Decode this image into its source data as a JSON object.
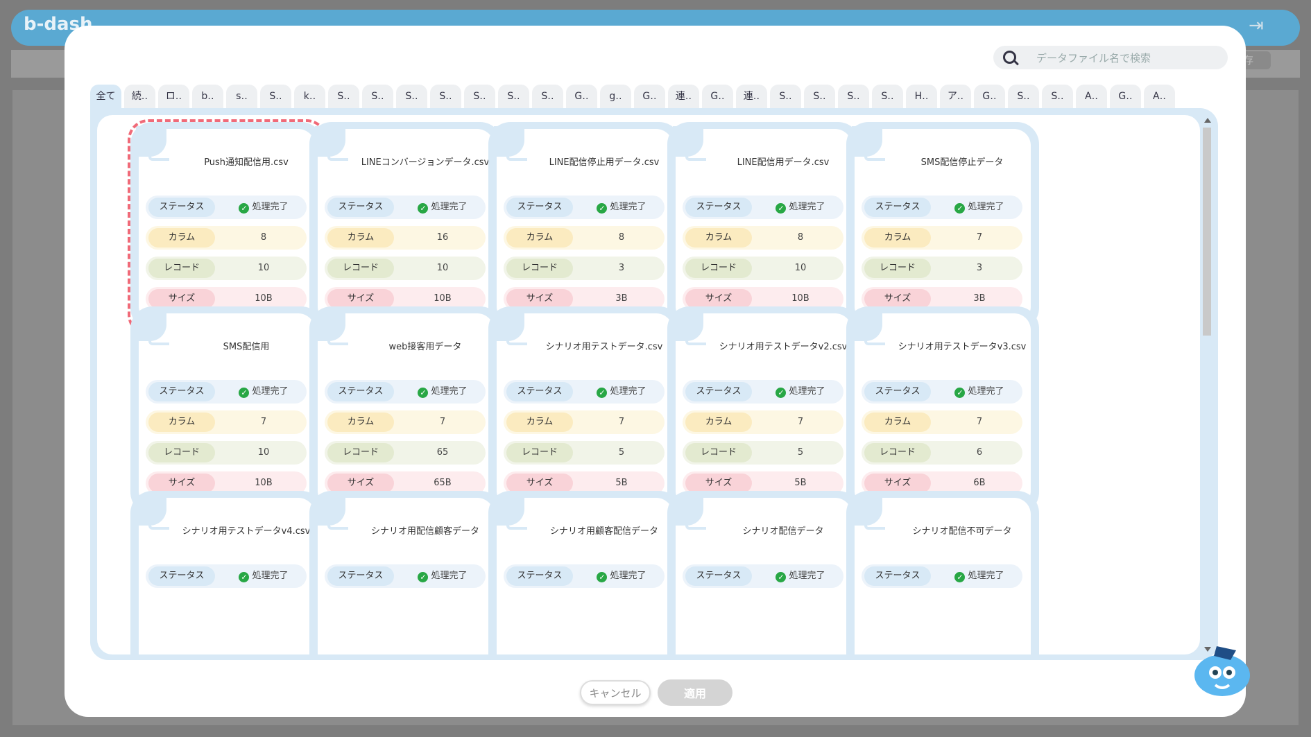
{
  "app": {
    "logo": "b-dash",
    "save_label": "保存"
  },
  "search": {
    "placeholder": "データファイル名で検索"
  },
  "tabs": [
    "全て",
    "続‥",
    "ロ‥",
    "b‥",
    "s‥",
    "S‥",
    "k‥",
    "S‥",
    "S‥",
    "S‥",
    "S‥",
    "S‥",
    "S‥",
    "S‥",
    "G‥",
    "g‥",
    "G‥",
    "連‥",
    "G‥",
    "連‥",
    "S‥",
    "S‥",
    "S‥",
    "S‥",
    "H‥",
    "ア‥",
    "G‥",
    "S‥",
    "S‥",
    "A‥",
    "G‥",
    "A‥"
  ],
  "labels": {
    "status": "ステータス",
    "columns": "カラム",
    "records": "レコード",
    "size": "サイズ"
  },
  "files": [
    {
      "name": "Push通知配信用.csv",
      "status": "処理完了",
      "columns": "8",
      "records": "10",
      "size": "10B",
      "selected": true
    },
    {
      "name": "LINEコンバージョンデータ.csv",
      "status": "処理完了",
      "columns": "16",
      "records": "10",
      "size": "10B"
    },
    {
      "name": "LINE配信停止用データ.csv",
      "status": "処理完了",
      "columns": "8",
      "records": "3",
      "size": "3B"
    },
    {
      "name": "LINE配信用データ.csv",
      "status": "処理完了",
      "columns": "8",
      "records": "10",
      "size": "10B"
    },
    {
      "name": "SMS配信停止データ",
      "status": "処理完了",
      "columns": "7",
      "records": "3",
      "size": "3B"
    },
    {
      "name": "SMS配信用",
      "status": "処理完了",
      "columns": "7",
      "records": "10",
      "size": "10B"
    },
    {
      "name": "web接客用データ",
      "status": "処理完了",
      "columns": "7",
      "records": "65",
      "size": "65B"
    },
    {
      "name": "シナリオ用テストデータ.csv",
      "status": "処理完了",
      "columns": "7",
      "records": "5",
      "size": "5B"
    },
    {
      "name": "シナリオ用テストデータv2.csv",
      "status": "処理完了",
      "columns": "7",
      "records": "5",
      "size": "5B"
    },
    {
      "name": "シナリオ用テストデータv3.csv",
      "status": "処理完了",
      "columns": "7",
      "records": "6",
      "size": "6B"
    },
    {
      "name": "シナリオ用テストデータv4.csv",
      "status": "処理完了"
    },
    {
      "name": "シナリオ用配信顧客データ",
      "status": "処理完了"
    },
    {
      "name": "シナリオ用顧客配信データ",
      "status": "処理完了"
    },
    {
      "name": "シナリオ配信データ",
      "status": "処理完了"
    },
    {
      "name": "シナリオ配信不可データ",
      "status": "処理完了"
    }
  ],
  "buttons": {
    "cancel": "キャンセル",
    "apply": "適用"
  }
}
